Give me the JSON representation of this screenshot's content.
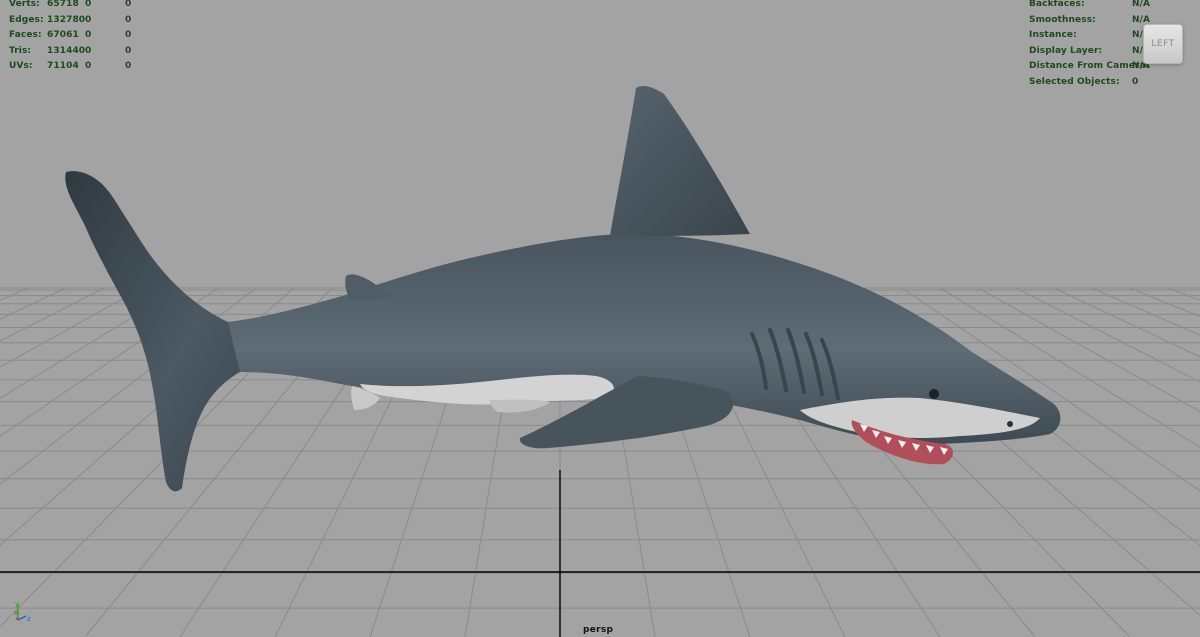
{
  "viewport": {
    "camera": "persp",
    "view_cube_label": "LEFT",
    "background_color": "#a3a3a3",
    "grid_color": "#8a8a8a",
    "axis_color": "#000000"
  },
  "hud_left": {
    "rows": [
      {
        "label": "Verts:",
        "v1": "65718",
        "v2": "0",
        "v3": "0"
      },
      {
        "label": "Edges:",
        "v1": "132780",
        "v2": "0",
        "v3": "0"
      },
      {
        "label": "Faces:",
        "v1": "67061",
        "v2": "0",
        "v3": "0"
      },
      {
        "label": "Tris:",
        "v1": "131440",
        "v2": "0",
        "v3": "0"
      },
      {
        "label": "UVs:",
        "v1": "71104",
        "v2": "0",
        "v3": "0"
      }
    ]
  },
  "hud_right": {
    "rows": [
      {
        "label": "Backfaces:",
        "value": "N/A"
      },
      {
        "label": "Smoothness:",
        "value": "N/A"
      },
      {
        "label": "Instance:",
        "value": "N/A"
      },
      {
        "label": "Display Layer:",
        "value": "N/A"
      },
      {
        "label": "Distance From Camera:",
        "value": "N/A"
      },
      {
        "label": "Selected Objects:",
        "value": "0"
      }
    ]
  },
  "axis_gizmo": {
    "labels": [
      "y",
      "x",
      "z"
    ]
  },
  "model": {
    "name": "shark-model",
    "body_color": "#5d6b75",
    "belly_color": "#d6d6d6",
    "mouth_color": "#b04f5a"
  },
  "hud_text_color": "#1d4a1d"
}
